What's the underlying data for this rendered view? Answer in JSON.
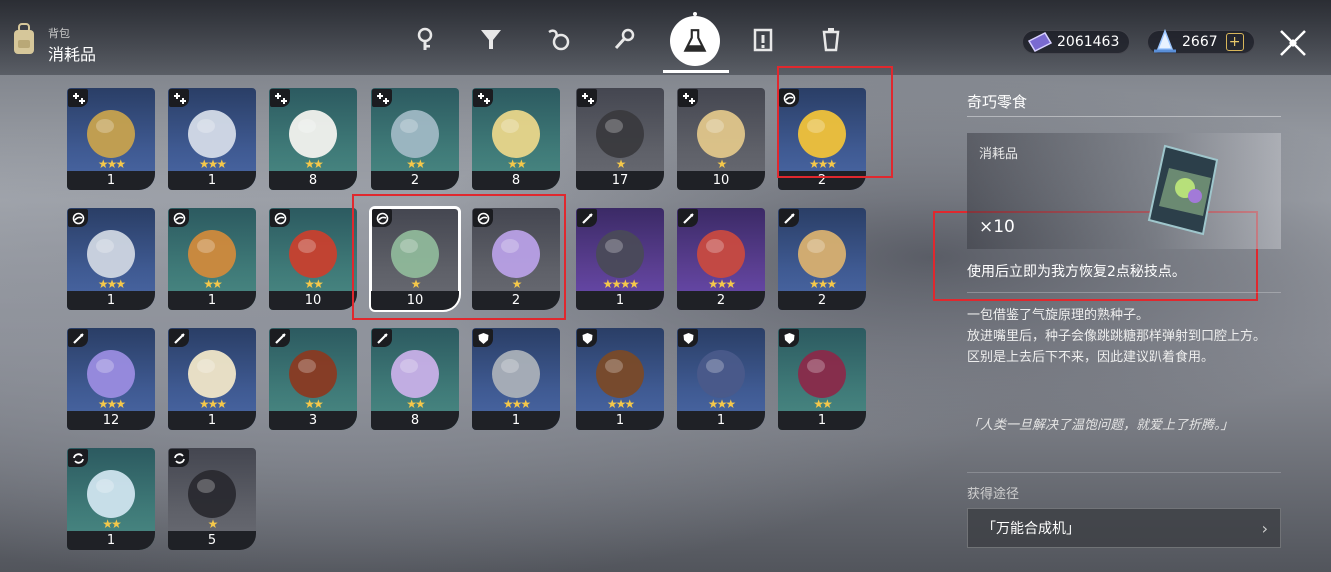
{
  "header": {
    "crumb_small": "背包",
    "crumb_big": "消耗品",
    "tabs": [
      "key-icon",
      "funnel-icon",
      "swirl-icon",
      "wrench-icon",
      "flask-icon",
      "clipboard-icon",
      "trash-icon"
    ],
    "active_tab": "flask-icon",
    "currency1": "2061463",
    "currency2": "2667",
    "currency2_plus": "+"
  },
  "items": [
    {
      "count": "1",
      "stars": "★★★",
      "badge": "plus",
      "rarity": "r3",
      "icon": "bottle-icon"
    },
    {
      "count": "1",
      "stars": "★★★",
      "badge": "plus",
      "rarity": "r3",
      "icon": "can-icon"
    },
    {
      "count": "8",
      "stars": "★★",
      "badge": "plus",
      "rarity": "r2",
      "icon": "rice-bowl-icon"
    },
    {
      "count": "2",
      "stars": "★★",
      "badge": "plus",
      "rarity": "r2",
      "icon": "spray-icon"
    },
    {
      "count": "8",
      "stars": "★★",
      "badge": "plus",
      "rarity": "r2",
      "icon": "fried-rice-icon"
    },
    {
      "count": "17",
      "stars": "★",
      "badge": "plus",
      "rarity": "r1",
      "icon": "device-icon"
    },
    {
      "count": "10",
      "stars": "★",
      "badge": "plus",
      "rarity": "r1",
      "icon": "noodle-bowl-icon"
    },
    {
      "count": "2",
      "stars": "★★★",
      "badge": "swirl",
      "rarity": "r3",
      "icon": "golden-pouch-icon"
    },
    {
      "count": "1",
      "stars": "★★★",
      "badge": "swirl",
      "rarity": "r3",
      "icon": "water-bottle-icon"
    },
    {
      "count": "1",
      "stars": "★★",
      "badge": "swirl",
      "rarity": "r2",
      "icon": "pancake-plate-icon"
    },
    {
      "count": "10",
      "stars": "★★",
      "badge": "swirl",
      "rarity": "r2",
      "icon": "soda-bottle-icon"
    },
    {
      "count": "10",
      "stars": "★",
      "badge": "swirl",
      "rarity": "r1",
      "icon": "snack-bag-icon"
    },
    {
      "count": "2",
      "stars": "★",
      "badge": "swirl",
      "rarity": "r1",
      "icon": "purple-bowl-icon"
    },
    {
      "count": "1",
      "stars": "★★★★",
      "badge": "sword",
      "rarity": "r4",
      "icon": "striped-wrap-icon"
    },
    {
      "count": "2",
      "stars": "★★★",
      "badge": "sword",
      "rarity": "r4",
      "icon": "bandage-icon"
    },
    {
      "count": "2",
      "stars": "★★★",
      "badge": "sword",
      "rarity": "r3",
      "icon": "drink-cup-icon"
    },
    {
      "count": "12",
      "stars": "★★★",
      "badge": "sword",
      "rarity": "r3",
      "icon": "potion-flask-icon"
    },
    {
      "count": "1",
      "stars": "★★★",
      "badge": "sword",
      "rarity": "r3",
      "icon": "tube-icon"
    },
    {
      "count": "3",
      "stars": "★★",
      "badge": "sword",
      "rarity": "r2",
      "icon": "roast-icon"
    },
    {
      "count": "8",
      "stars": "★★",
      "badge": "sword",
      "rarity": "r2",
      "icon": "rice-purple-bowl-icon"
    },
    {
      "count": "1",
      "stars": "★★★",
      "badge": "shield",
      "rarity": "r3",
      "icon": "trash-can-icon"
    },
    {
      "count": "1",
      "stars": "★★★",
      "badge": "shield",
      "rarity": "r3",
      "icon": "log-icon"
    },
    {
      "count": "1",
      "stars": "★★★",
      "badge": "shield",
      "rarity": "r3",
      "icon": "robot-icon"
    },
    {
      "count": "1",
      "stars": "★★",
      "badge": "shield",
      "rarity": "r2",
      "icon": "red-bottle-icon"
    },
    {
      "count": "1",
      "stars": "★★",
      "badge": "cycle",
      "rarity": "r2",
      "icon": "pitcher-icon"
    },
    {
      "count": "5",
      "stars": "★",
      "badge": "cycle",
      "rarity": "r1",
      "icon": "black-bag-icon"
    }
  ],
  "selected_index": 11,
  "detail": {
    "title": "奇巧零食",
    "type": "消耗品",
    "quantity": "×10",
    "effect": "使用后立即为我方恢复2点秘技点。",
    "description": [
      "一包借鉴了气旋原理的熟种子。",
      "放进嘴里后，种子会像跳跳糖那样弹射到口腔上方。",
      "区别是上去后下不来，因此建议趴着食用。"
    ],
    "quote": "「人类一旦解决了温饱问题，就爱上了折腾。」",
    "source_label": "获得途径",
    "source": "「万能合成机」"
  },
  "colors": {
    "accent_star": "#f5c84a",
    "highlight_box": "#e0282e"
  }
}
